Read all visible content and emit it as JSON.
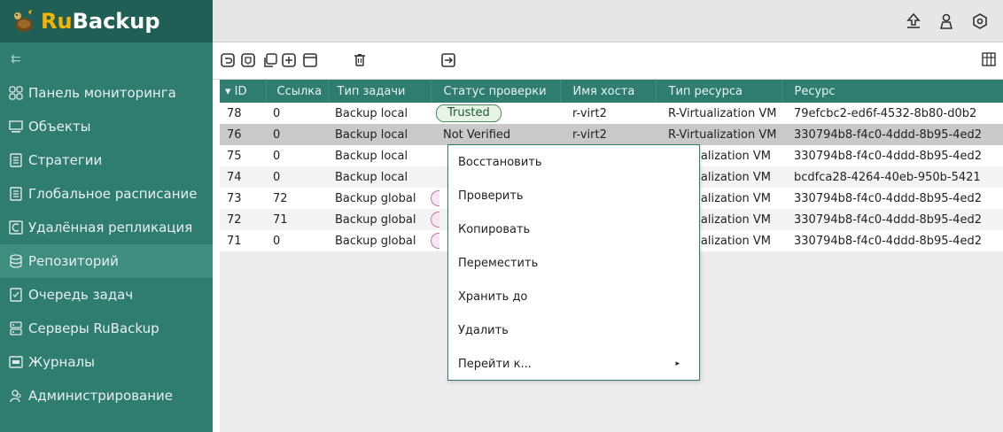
{
  "app": {
    "logo_ru": "Ru",
    "logo_backup": "Backup"
  },
  "sidebar": {
    "collapse_glyph": "⇇",
    "items": [
      {
        "label": "Панель мониторинга",
        "icon": "dashboard-icon"
      },
      {
        "label": "Объекты",
        "icon": "monitor-icon"
      },
      {
        "label": "Стратегии",
        "icon": "document-icon"
      },
      {
        "label": "Глобальное расписание",
        "icon": "schedule-icon"
      },
      {
        "label": "Удалённая репликация",
        "icon": "replication-icon"
      },
      {
        "label": "Репозиторий",
        "icon": "database-icon",
        "active": true
      },
      {
        "label": "Очередь задач",
        "icon": "task-queue-icon"
      },
      {
        "label": "Серверы RuBackup",
        "icon": "server-icon"
      },
      {
        "label": "Журналы",
        "icon": "log-icon"
      },
      {
        "label": "Администрирование",
        "icon": "users-icon"
      }
    ]
  },
  "table": {
    "columns": [
      "▾ ID",
      "Ссылка",
      "Тип задачи",
      "Статус проверки",
      "Имя хоста",
      "Тип ресурса",
      "Ресурс"
    ],
    "rows": [
      {
        "id": "78",
        "link": "0",
        "task_type": "Backup local",
        "status": "Trusted",
        "host": "r-virt2",
        "resource_type": "R-Virtualization VM",
        "resource": "79efcbc2-ed6f-4532-8b80-d0b2"
      },
      {
        "id": "76",
        "link": "0",
        "task_type": "Backup local",
        "status": "Not Verified",
        "host": "r-virt2",
        "resource_type": "R-Virtualization VM",
        "resource": "330794b8-f4c0-4ddd-8b95-4ed2"
      },
      {
        "id": "75",
        "link": "0",
        "task_type": "Backup local",
        "status": "",
        "host": "",
        "resource_type": "Virtualization VM",
        "resource": "330794b8-f4c0-4ddd-8b95-4ed2"
      },
      {
        "id": "74",
        "link": "0",
        "task_type": "Backup local",
        "status": "",
        "host": "",
        "resource_type": "Virtualization VM",
        "resource": "bcdfca28-4264-40eb-950b-5421"
      },
      {
        "id": "73",
        "link": "72",
        "task_type": "Backup global",
        "status": "",
        "host": "",
        "resource_type": "Virtualization VM",
        "resource": "330794b8-f4c0-4ddd-8b95-4ed2"
      },
      {
        "id": "72",
        "link": "71",
        "task_type": "Backup global",
        "status": "",
        "host": "",
        "resource_type": "Virtualization VM",
        "resource": "330794b8-f4c0-4ddd-8b95-4ed2"
      },
      {
        "id": "71",
        "link": "0",
        "task_type": "Backup global",
        "status": "",
        "host": "",
        "resource_type": "Virtualization VM",
        "resource": "330794b8-f4c0-4ddd-8b95-4ed2"
      }
    ]
  },
  "context_menu": {
    "items": [
      "Восстановить",
      "Проверить",
      "Копировать",
      "Переместить",
      "Хранить до",
      "Удалить",
      "Перейти к..."
    ],
    "submenu_arrow": "▸"
  },
  "colors": {
    "sidebar": "#2f7d71",
    "header": "#2f7d71",
    "logo_bg": "#1f5f55",
    "accent_gold": "#f2b400"
  }
}
